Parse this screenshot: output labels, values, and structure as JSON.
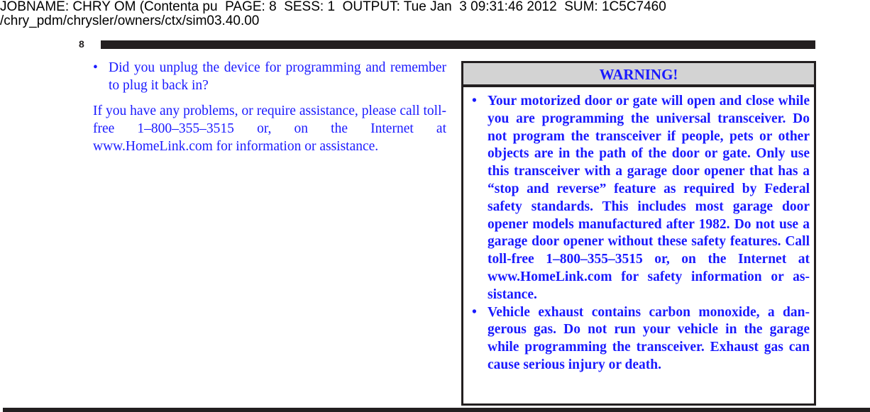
{
  "job_header": {
    "line1": "JOBNAME: CHRY OM (Contenta pu  PAGE: 8  SESS: 1  OUTPUT: Tue Jan  3 09:31:46 2012  SUM: 1C5C7460",
    "line2": "/chry_pdm/chrysler/owners/ctx/sim03.40.00"
  },
  "page_number": "8",
  "left_column": {
    "bullet_marker": "•",
    "bullet_text": "Did you unplug the device for programming and remember to plug it back in?",
    "paragraph": "If you have any problems, or require assistance, please call toll-free 1–800–355–3515 or, on the Internet at www.HomeLink.com for information or assistance."
  },
  "warning": {
    "title": "WARNING!",
    "bullet_marker": "•",
    "items": [
      "Your motorized door or gate will open and close while you are programming the universal trans­ceiver. Do not program the transceiver if people, pets or other objects are in the path of the door or gate. Only use this transceiver with a garage door opener that has a “stop and reverse” feature as required by Federal safety standards. This in­cludes most garage door opener models manufac­tured after 1982. Do not use a garage door opener without these safety features. Call toll-free 1–800–355–3515 or, on the Internet at www.HomeLink.com for safety information or as­sistance.",
      "Vehicle exhaust contains carbon monoxide, a dan­gerous gas. Do not run your vehicle in the garage while programming the transceiver. Exhaust gas can cause serious injury or death."
    ]
  },
  "colors": {
    "text_blue": "#1a1aff",
    "rule_black": "#231f20",
    "warning_header_bg": "#d3d3d3"
  }
}
